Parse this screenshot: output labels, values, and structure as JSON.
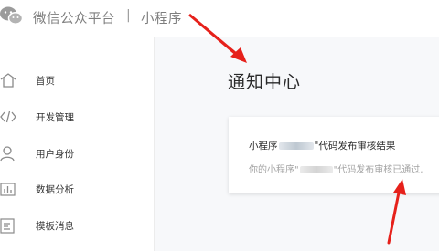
{
  "header": {
    "brand": "微信公众平台",
    "separator": "|",
    "product": "小程序"
  },
  "sidebar": {
    "items": [
      {
        "label": "首页",
        "icon": "home-icon"
      },
      {
        "label": "开发管理",
        "icon": "code-icon"
      },
      {
        "label": "用户身份",
        "icon": "user-icon"
      },
      {
        "label": "数据分析",
        "icon": "bar-chart-icon"
      },
      {
        "label": "模板消息",
        "icon": "template-icon"
      }
    ]
  },
  "main": {
    "title": "通知中心",
    "message": {
      "title_prefix": "小程序",
      "title_suffix": "\"代码发布审核结果",
      "body_prefix": "你的小程序\"",
      "body_suffix": "\"代码发布审核已通过,"
    }
  },
  "colors": {
    "annotation_arrow": "#e6211b",
    "background": "#f7f8fa",
    "sidebar_bg": "#ffffff"
  }
}
